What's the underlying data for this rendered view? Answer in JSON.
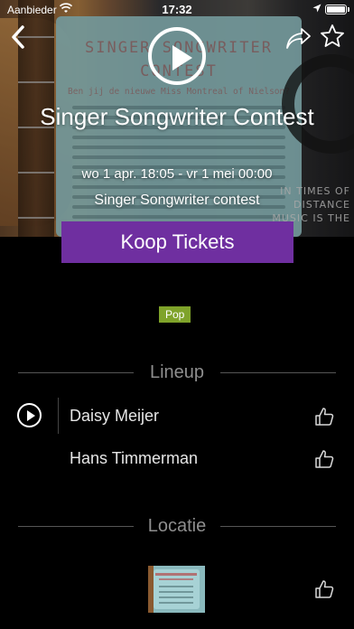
{
  "status_bar": {
    "carrier": "Aanbieder",
    "time": "17:32"
  },
  "hero": {
    "poster_title": "SINGER SONGWRITER CONTEST",
    "poster_subtitle": "Ben jij de nieuwe Miss Montreal of Nielson?",
    "side_text": "IN TIMES OF DISTANCE MUSIC IS THE"
  },
  "event": {
    "title": "Singer Songwriter Contest",
    "date": "wo 1 apr. 18:05 - vr 1 mei 00:00",
    "subtitle": "Singer Songwriter contest"
  },
  "tickets_button": "Koop Tickets",
  "genre_tag": "Pop",
  "lineup": {
    "header": "Lineup",
    "artists": [
      {
        "name": "Daisy Meijer"
      },
      {
        "name": "Hans Timmerman"
      }
    ]
  },
  "location": {
    "header": "Locatie"
  },
  "colors": {
    "background": "#000000",
    "tickets_button": "#6f2fa0",
    "genre_tag": "#7fa32a",
    "section_header": "#8e8e8e"
  },
  "icons": {
    "back": "chevron-left-icon",
    "share": "share-icon",
    "favorite": "star-icon",
    "play": "play-icon",
    "like": "thumbs-up-icon"
  }
}
